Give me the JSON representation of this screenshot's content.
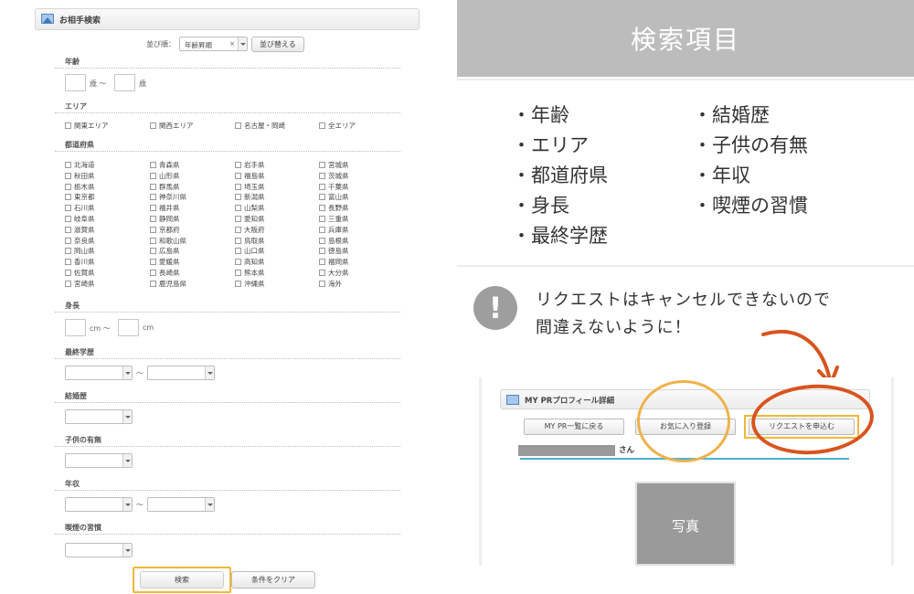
{
  "left": {
    "panel_title": "お相手検索",
    "sort": {
      "label": "並び順：",
      "selected": "年齢昇順",
      "clear_x": "×",
      "button": "並び替える"
    },
    "age": {
      "label": "年齢",
      "unit_from": "歳 〜",
      "unit_to": "歳"
    },
    "area": {
      "label": "エリア",
      "options": [
        "関東エリア",
        "関西エリア",
        "名古屋・岡崎",
        "全エリア"
      ]
    },
    "prefecture": {
      "label": "都道府県",
      "columns": [
        [
          "北海道",
          "秋田県",
          "栃木県",
          "東京都",
          "石川県",
          "岐阜県",
          "滋賀県",
          "奈良県",
          "岡山県",
          "香川県",
          "佐賀県",
          "宮崎県"
        ],
        [
          "青森県",
          "山形県",
          "群馬県",
          "神奈川県",
          "福井県",
          "静岡県",
          "京都府",
          "和歌山県",
          "広島県",
          "愛媛県",
          "長崎県",
          "鹿児島県"
        ],
        [
          "岩手県",
          "福島県",
          "埼玉県",
          "新潟県",
          "山梨県",
          "愛知県",
          "大阪府",
          "鳥取県",
          "山口県",
          "高知県",
          "熊本県",
          "沖縄県"
        ],
        [
          "宮城県",
          "茨城県",
          "千葉県",
          "富山県",
          "長野県",
          "三重県",
          "兵庫県",
          "島根県",
          "徳島県",
          "福岡県",
          "大分県",
          "海外"
        ]
      ]
    },
    "height": {
      "label": "身長",
      "unit_from": "cm 〜",
      "unit_to": "cm"
    },
    "education": {
      "label": "最終学歴",
      "tilde": "〜"
    },
    "marriage": {
      "label": "結婚歴"
    },
    "children": {
      "label": "子供の有無"
    },
    "income": {
      "label": "年収",
      "tilde": "〜"
    },
    "smoking": {
      "label": "喫煙の習慣"
    },
    "search_button": "検索",
    "clear_button": "条件をクリア"
  },
  "right": {
    "title": "検索項目",
    "items_col1": [
      "・年齢",
      "・エリア",
      "・都道府県",
      "・身長",
      "・最終学歴"
    ],
    "items_col2": [
      "・結婚歴",
      "・子供の有無",
      "・年収",
      "・喫煙の習慣"
    ],
    "warning_icon": "!",
    "warning_line1": "リクエストはキャンセルできないので",
    "warning_line2": "間違えないように！",
    "screenshot": {
      "panel_title": "MY PRプロフィール詳細",
      "btn_back": "MY PR一覧に戻る",
      "btn_favorite": "お気に入り登録",
      "btn_request": "リクエストを申込む",
      "name_suffix": "さん",
      "photo_label": "写真"
    }
  },
  "colors": {
    "highlight_yellow": "#f2b738",
    "circle_orange": "#f0b14a",
    "circle_red": "#d8541e",
    "header_grey": "#bcbcbc",
    "accent_blue": "#4fb0d8"
  }
}
